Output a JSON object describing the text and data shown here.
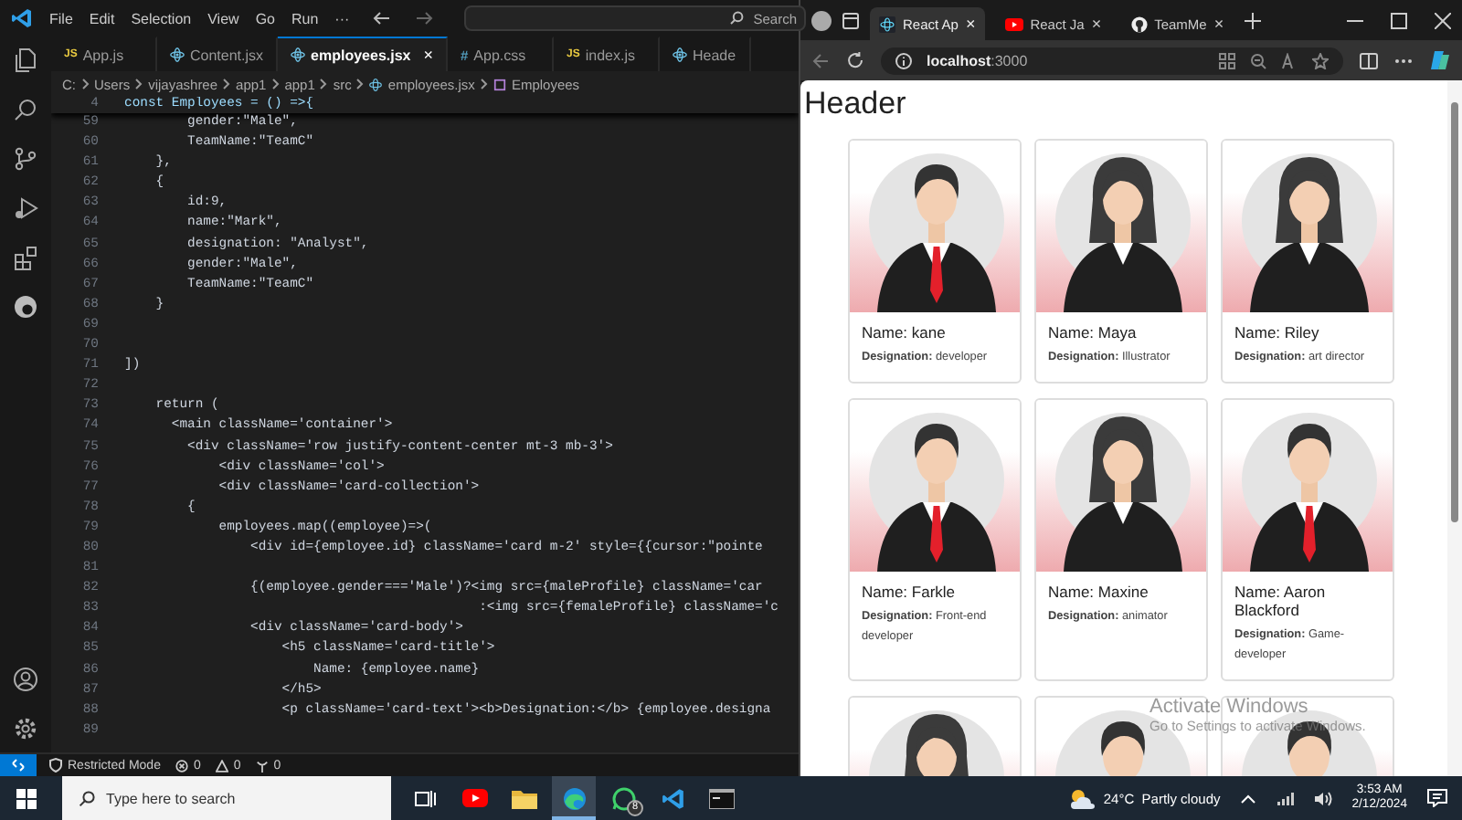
{
  "vscode": {
    "menu": [
      "File",
      "Edit",
      "Selection",
      "View",
      "Go",
      "Run",
      "···"
    ],
    "search": {
      "placeholder": "Search"
    },
    "tabs": [
      {
        "label": "App.js",
        "kind": "js",
        "badge": "JS",
        "selected": false
      },
      {
        "label": "Content.jsx",
        "kind": "react",
        "selected": false
      },
      {
        "label": "employees.jsx",
        "kind": "react",
        "selected": true,
        "close": "×"
      },
      {
        "label": "App.css",
        "kind": "css",
        "badge": "#",
        "selected": false
      },
      {
        "label": "index.js",
        "kind": "js",
        "badge": "JS",
        "selected": false
      },
      {
        "label": "Heade",
        "kind": "react",
        "selected": false
      }
    ],
    "breadcrumb": [
      {
        "label": "C:",
        "kind": "folder"
      },
      {
        "label": "Users",
        "kind": "folder"
      },
      {
        "label": "vijayashree",
        "kind": "folder"
      },
      {
        "label": "app1",
        "kind": "folder"
      },
      {
        "label": "app1",
        "kind": "folder"
      },
      {
        "label": "src",
        "kind": "folder"
      },
      {
        "label": "employees.jsx",
        "kind": "react"
      },
      {
        "label": "Employees",
        "kind": "symbol"
      }
    ],
    "sticky_line": {
      "number": "4",
      "text": "const Employees = () =>{"
    },
    "lines": [
      {
        "number": "59",
        "text": "        gender:\"Male\","
      },
      {
        "number": "60",
        "text": "        TeamName:\"TeamC\""
      },
      {
        "number": "61",
        "text": "    },"
      },
      {
        "number": "62",
        "text": "    {"
      },
      {
        "number": "63",
        "text": "        id:9,"
      },
      {
        "number": "64",
        "text": "        name:\"Mark\","
      },
      {
        "number": "65",
        "text": "        designation: \"Analyst\","
      },
      {
        "number": "66",
        "text": "        gender:\"Male\","
      },
      {
        "number": "67",
        "text": "        TeamName:\"TeamC\""
      },
      {
        "number": "68",
        "text": "    }"
      },
      {
        "number": "69"
      },
      {
        "number": "70"
      },
      {
        "number": "71",
        "text": "])"
      },
      {
        "number": "72"
      },
      {
        "number": "73",
        "text": "    return ("
      },
      {
        "number": "74",
        "text": "      <main className='container'>"
      },
      {
        "number": "75",
        "text": "        <div className='row justify-content-center mt-3 mb-3'>"
      },
      {
        "number": "76",
        "text": "            <div className='col'>"
      },
      {
        "number": "77",
        "text": "            <div className='card-collection'>"
      },
      {
        "number": "78",
        "text": "        {"
      },
      {
        "number": "79",
        "text": "            employees.map((employee)=>("
      },
      {
        "number": "80",
        "text": "                <div id={employee.id} className='card m-2' style={{cursor:\"pointe"
      },
      {
        "number": "81"
      },
      {
        "number": "82",
        "text": "                {(employee.gender==='Male')?<img src={maleProfile} className='car"
      },
      {
        "number": "83",
        "text": "                                             :<img src={femaleProfile} className='c"
      },
      {
        "number": "84",
        "text": "                <div className='card-body'>"
      },
      {
        "number": "85",
        "text": "                    <h5 className='card-title'>"
      },
      {
        "number": "86",
        "text": "                        Name: {employee.name}"
      },
      {
        "number": "87",
        "text": "                    </h5>"
      },
      {
        "number": "88",
        "text": "                    <p className='card-text'><b>Designation:</b> {employee.designa"
      },
      {
        "number": "89"
      }
    ],
    "status_bar": {
      "mode": "Restricted Mode",
      "errors": "0",
      "warnings": "0",
      "ports": "0"
    }
  },
  "browser": {
    "tabs": [
      {
        "label": "React Ap",
        "kind": "react",
        "selected": true,
        "close": "×"
      },
      {
        "label": "React Ja",
        "kind": "youtube",
        "selected": false,
        "close": "×"
      },
      {
        "label": "TeamMe",
        "kind": "github",
        "selected": false,
        "close": "×"
      }
    ],
    "url": "**localhost**:3000",
    "heading": "Header",
    "cards": [
      {
        "kind": "male",
        "name": "Name: kane",
        "designation": "**Designation:** developer"
      },
      {
        "kind": "female",
        "name": "Name: Maya",
        "designation": "**Designation:** Illustrator"
      },
      {
        "kind": "female",
        "name": "Name: Riley",
        "designation": "**Designation:** art director"
      },
      {
        "kind": "male",
        "name": "Name: Farkle",
        "designation": "**Designation:** Front-end developer"
      },
      {
        "kind": "female",
        "name": "Name: Maxine",
        "designation": "**Designation:** animator"
      },
      {
        "kind": "male",
        "name": "Name: Aaron Blackford",
        "designation": "**Designation:** Game-developer"
      },
      {
        "kind": "female"
      },
      {
        "kind": "male"
      },
      {
        "kind": "male"
      }
    ]
  },
  "activation_notice": {
    "title": "Activate Windows",
    "text": "Go to Settings to activate Windows."
  },
  "taskbar": {
    "search": {
      "placeholder": "Type here to search"
    },
    "apps": [
      {
        "kind": "taskview",
        "selected": false
      },
      {
        "kind": "youtube",
        "selected": false
      },
      {
        "kind": "folder",
        "selected": false
      },
      {
        "kind": "edge",
        "selected": true
      },
      {
        "kind": "whatsapp",
        "selected": false,
        "badge": "8"
      },
      {
        "kind": "vscode",
        "selected": false
      },
      {
        "kind": "terminal",
        "selected": false
      }
    ],
    "weather": "24°C  Partly cloudy",
    "time": "3:53 AM",
    "date": "2/12/2024"
  }
}
